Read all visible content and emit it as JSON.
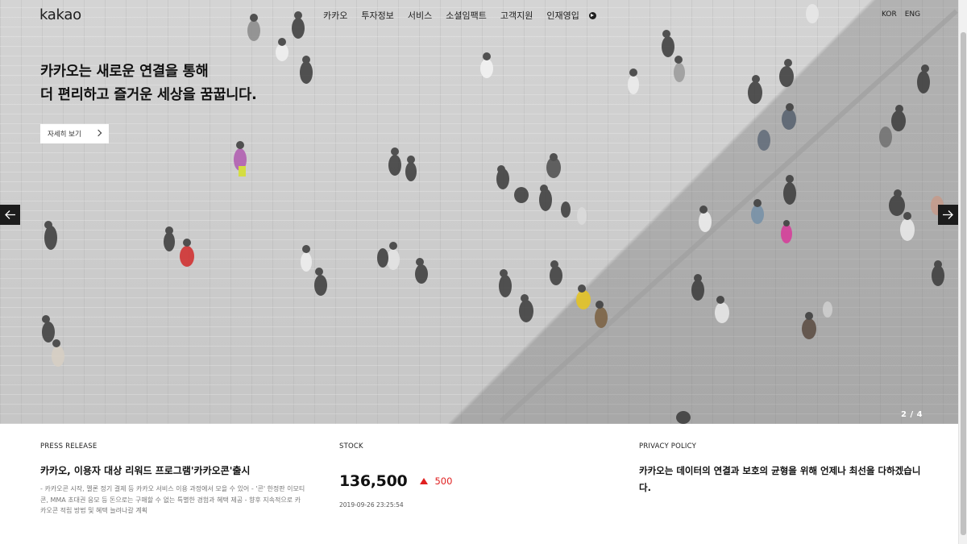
{
  "header": {
    "logo": "kakao",
    "nav": [
      "카카오",
      "투자정보",
      "서비스",
      "소셜임팩트",
      "고객지원",
      "인재영입"
    ],
    "lang": [
      "KOR",
      "ENG"
    ]
  },
  "hero": {
    "line1": "카카오는 새로운 연결을 통해",
    "line2": "더 편리하고 즐거운 세상을 꿈꿉니다.",
    "button_label": "자세히 보기",
    "pager": "2 / 4"
  },
  "press": {
    "label": "PRESS RELEASE",
    "title": "카카오, 이용자 대상 리워드 프로그램'카카오콘'출시",
    "body": "- 카카오콘 시작, 멜론 정기 결제 등 카카오 서비스 이용 과정에서 모을 수 있어 - '콘' 한정판 이모티콘, MMA 초대권 응모 등 돈으로는 구매할 수 없는 특별한 경험과 혜택 제공 - 향후 지속적으로 카카오콘 적립 방법 및 혜택 늘려나갈 계획"
  },
  "stock": {
    "label": "STOCK",
    "price": "136,500",
    "change": "500",
    "timestamp": "2019-09-26 23:25:54",
    "up_color": "#e02020"
  },
  "privacy": {
    "label": "PRIVACY POLICY",
    "text": "카카오는 데이터의 연결과 보호의 균형을 위해 언제나 최선을 다하겠습니다."
  },
  "icons": {
    "nav_more": "arrow-right-circle-icon",
    "prev": "arrow-left-icon",
    "next": "arrow-right-icon",
    "button": "chevron-right-icon"
  }
}
